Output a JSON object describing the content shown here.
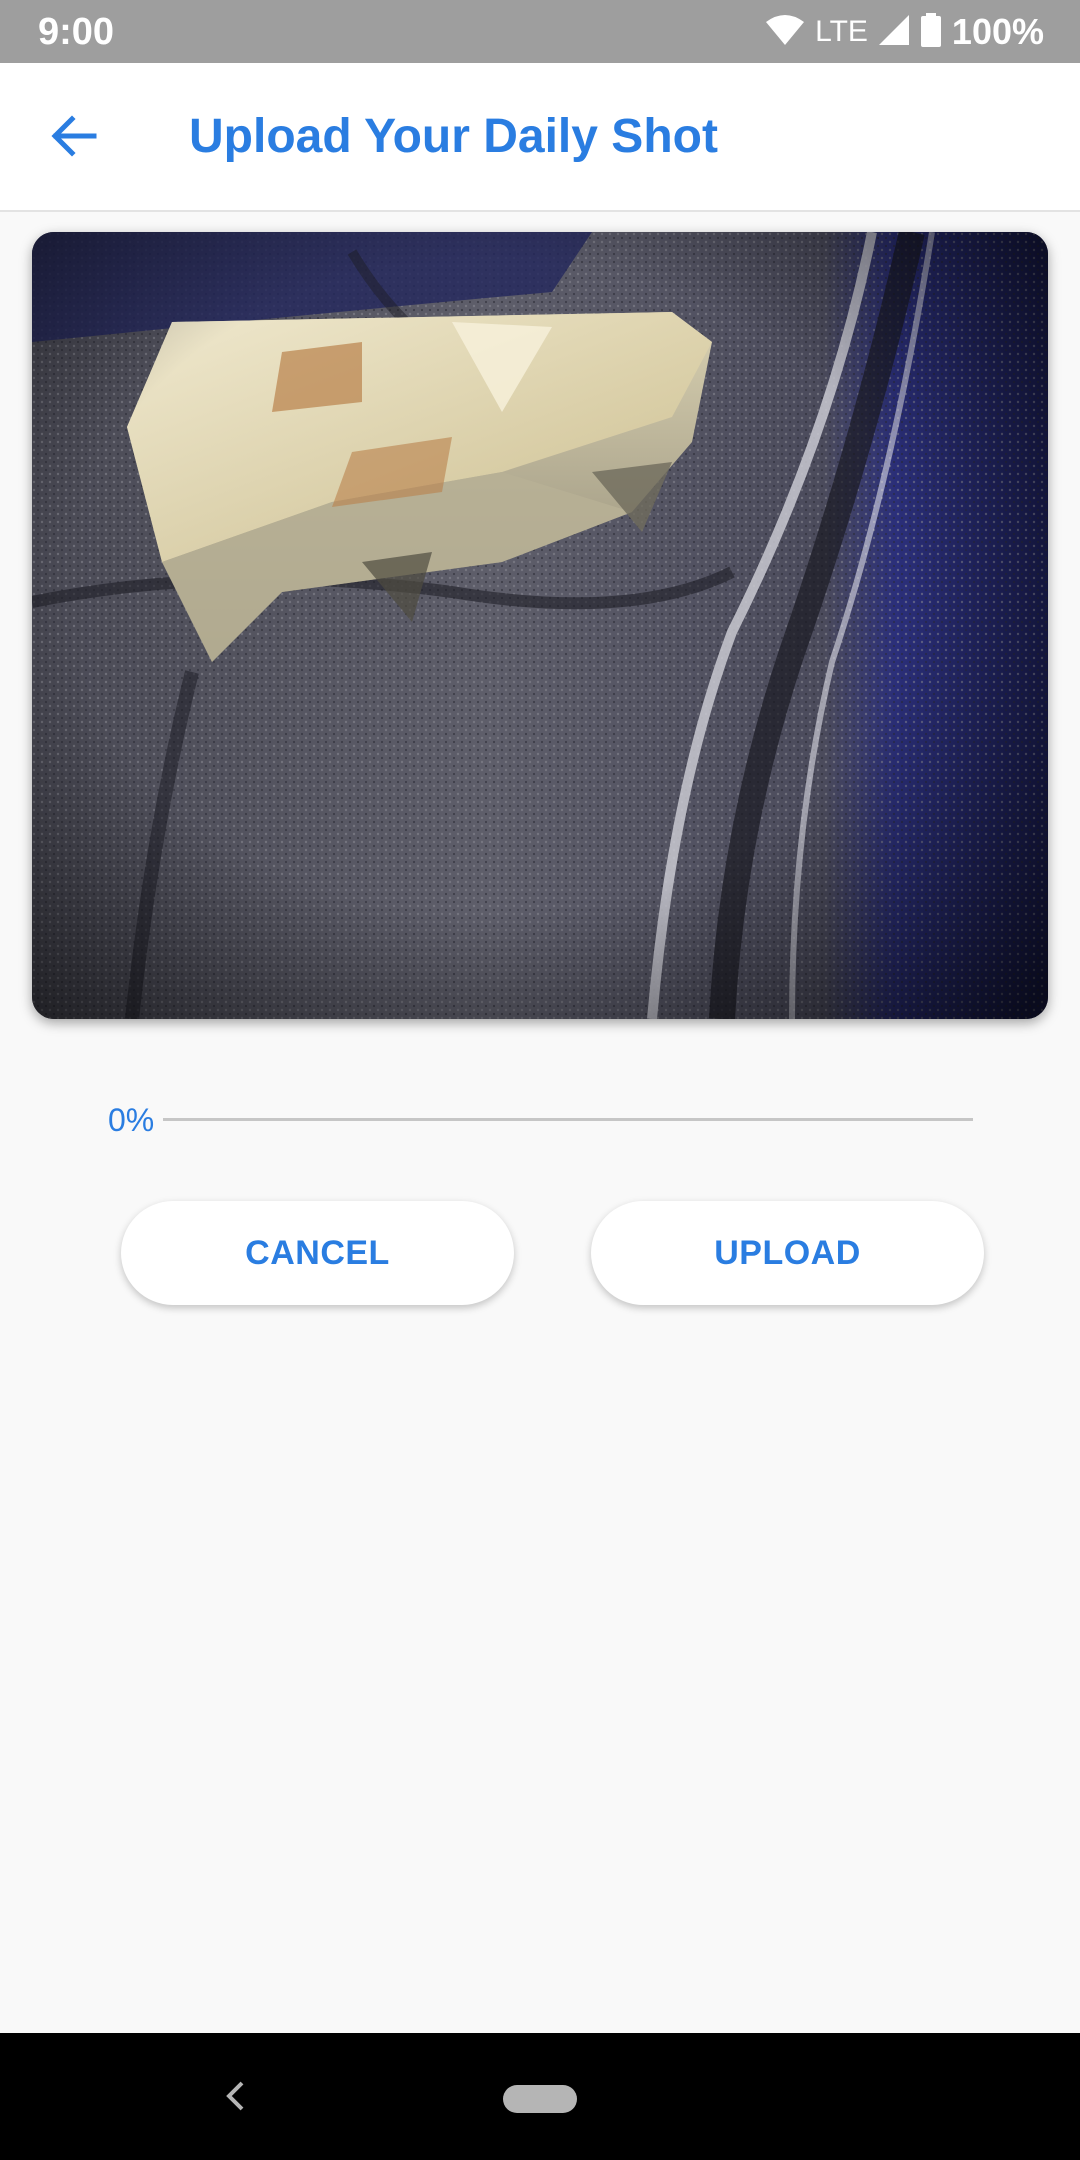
{
  "status_bar": {
    "time": "9:00",
    "network": "LTE",
    "battery": "100%",
    "icons": [
      "wifi-icon",
      "cell-signal-icon",
      "battery-icon"
    ]
  },
  "app_bar": {
    "title": "Upload Your Daily Shot",
    "back_icon": "arrow-left-icon"
  },
  "photo": {
    "description_icon": "photo-preview"
  },
  "progress": {
    "label": "0%",
    "value": 0
  },
  "buttons": {
    "cancel_label": "CANCEL",
    "upload_label": "UPLOAD"
  },
  "nav_bar": {
    "back_icon": "nav-back-icon",
    "home_icon": "nav-home-pill"
  },
  "colors": {
    "accent": "#2a7de1",
    "status_bar": "#9e9e9e",
    "background": "#f9f9f9"
  }
}
